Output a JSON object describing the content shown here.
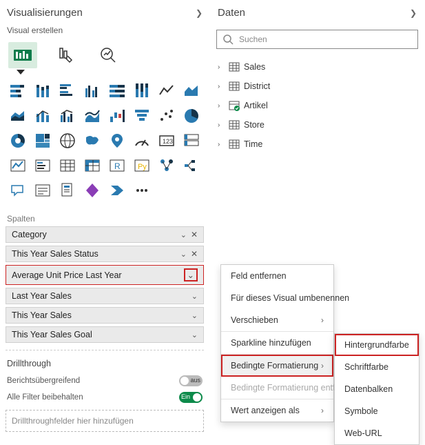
{
  "viz": {
    "title": "Visualisierungen",
    "subhead": "Visual erstellen",
    "columns_label": "Spalten",
    "fields": [
      {
        "label": "Category",
        "hasClose": true
      },
      {
        "label": "This Year Sales Status",
        "hasClose": true
      },
      {
        "label": "Average Unit Price Last Year",
        "highlight": true
      },
      {
        "label": "Last Year Sales"
      },
      {
        "label": "This Year Sales"
      },
      {
        "label": "This Year Sales Goal"
      }
    ],
    "drillthrough": {
      "title": "Drillthrough",
      "cross": "Berichtsübergreifend",
      "cross_state": "aus",
      "keep": "Alle Filter beibehalten",
      "keep_state": "Ein",
      "drop": "Drillthroughfelder hier hinzufügen"
    }
  },
  "data": {
    "title": "Daten",
    "search_placeholder": "Suchen",
    "tables": [
      "Sales",
      "District",
      "Artikel",
      "Store",
      "Time"
    ]
  },
  "context_menu": {
    "items": [
      {
        "label": "Feld entfernen"
      },
      {
        "label": "Für dieses Visual umbenennen"
      },
      {
        "label": "Verschieben",
        "submenu": true
      },
      {
        "label": "Sparkline hinzufügen"
      },
      {
        "label": "Bedingte Formatierung",
        "submenu": true,
        "selected": true
      },
      {
        "label": "Bedingte Formatierung entfernen",
        "disabled": true
      },
      {
        "label": "Wert anzeigen als",
        "submenu": true
      }
    ]
  },
  "submenu": {
    "items": [
      {
        "label": "Hintergrundfarbe",
        "highlight": true
      },
      {
        "label": "Schriftfarbe"
      },
      {
        "label": "Datenbalken"
      },
      {
        "label": "Symbole"
      },
      {
        "label": "Web-URL"
      }
    ]
  },
  "viz_icons": [
    "stacked-bar",
    "stacked-column",
    "clustered-bar",
    "clustered-column",
    "100-bar",
    "100-column",
    "line",
    "area",
    "stacked-area",
    "line-stacked-col",
    "line-clustered-col",
    "ribbon",
    "waterfall",
    "funnel",
    "scatter",
    "pie",
    "donut",
    "treemap",
    "map",
    "filled-map",
    "azure-map",
    "gauge",
    "card",
    "multi-row-card",
    "kpi",
    "slicer",
    "table",
    "matrix",
    "r-visual",
    "py-visual",
    "key-influencers",
    "decomposition",
    "qa",
    "narrative",
    "paginated",
    "powerapps",
    "powerautomate",
    "more"
  ]
}
